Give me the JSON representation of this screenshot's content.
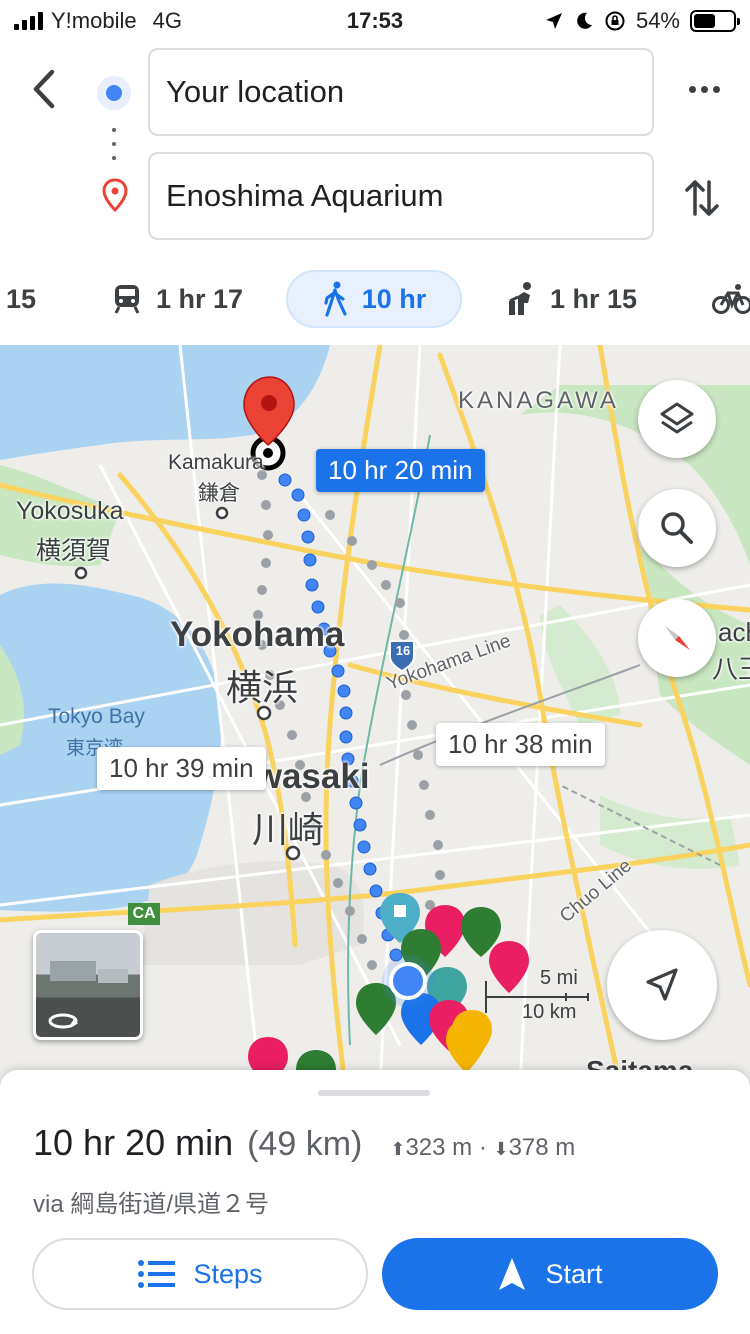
{
  "status_bar": {
    "carrier": "Y!mobile",
    "network": "4G",
    "time": "17:53",
    "battery": "54%",
    "battery_level": 0.54,
    "icons": [
      "location-arrow-icon",
      "moon-icon",
      "rotation-lock-icon"
    ]
  },
  "directions": {
    "origin": "Your location",
    "destination": "Enoshima Aquarium"
  },
  "modes": [
    {
      "icon": "car-icon",
      "label": "15"
    },
    {
      "icon": "train-icon",
      "label": "1 hr 17"
    },
    {
      "icon": "walk-icon",
      "label": "10 hr",
      "active": true
    },
    {
      "icon": "rideshare-icon",
      "label": "1 hr 15"
    },
    {
      "icon": "bike-icon",
      "label": ""
    }
  ],
  "map": {
    "labels": {
      "kanagawa": "KANAGAWA",
      "kamakura_en": "Kamakura",
      "kamakura_ja": "鎌倉",
      "yokosuka_en": "Yokosuka",
      "yokosuka_ja": "横須賀",
      "yokohama_en": "Yokohama",
      "yokohama_ja": "横浜",
      "tokyo_bay_en": "Tokyo Bay",
      "tokyo_bay_ja": "東京湾",
      "kawasaki_en": "Kawasaki",
      "kawasaki_ja": "川崎",
      "yokohama_line": "Yokohama Line",
      "chuo_line": "Chuo Line",
      "saitama": "Saitama",
      "hachioji_en": "ach",
      "hachioji_ja": "八王",
      "route_16": "16",
      "route_ca": "CA"
    },
    "route_bubbles": {
      "primary": "10 hr 20 min",
      "alt1": "10 hr 39 min",
      "alt2": "10 hr 38 min"
    },
    "scale": {
      "miles": "5 mi",
      "km": "10 km"
    },
    "colors": {
      "route_primary": "#4285f4",
      "route_alt": "#9aa0a6",
      "water": "#aad3f2",
      "park": "#c8e6c0",
      "road_major": "#f9d35e",
      "destination_pin": "#ea4335"
    }
  },
  "summary": {
    "duration": "10 hr 20 min",
    "distance": "(49 km)",
    "ascent": "323 m",
    "separator": "·",
    "descent": "378 m",
    "via": "via 綱島街道/県道２号"
  },
  "actions": {
    "steps": "Steps",
    "start": "Start"
  }
}
